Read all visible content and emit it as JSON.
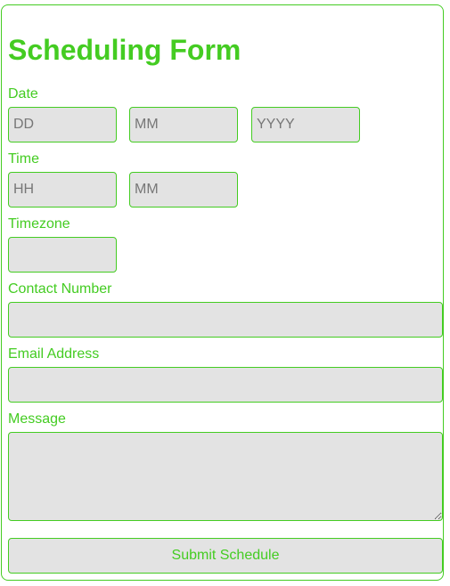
{
  "form": {
    "title": "Scheduling Form",
    "date": {
      "label": "Date",
      "day_placeholder": "DD",
      "month_placeholder": "MM",
      "year_placeholder": "YYYY"
    },
    "time": {
      "label": "Time",
      "hour_placeholder": "HH",
      "minute_placeholder": "MM"
    },
    "timezone": {
      "label": "Timezone"
    },
    "contact": {
      "label": "Contact Number"
    },
    "email": {
      "label": "Email Address"
    },
    "message": {
      "label": "Message"
    },
    "submit_label": "Submit Schedule"
  },
  "colors": {
    "accent": "#44cc22",
    "field_background": "#e3e3e3",
    "placeholder": "#777777"
  }
}
